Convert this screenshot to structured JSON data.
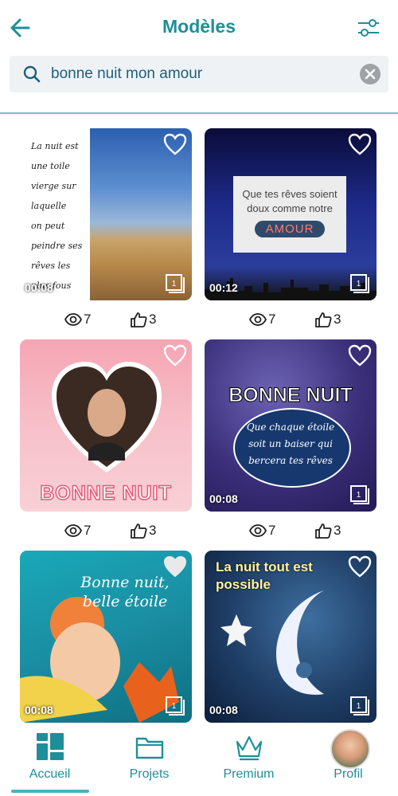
{
  "header": {
    "title": "Modèles"
  },
  "search": {
    "value": "bonne nuit mon amour",
    "placeholder": ""
  },
  "cards": [
    {
      "duration": "00:08",
      "views": "7",
      "likes": "3",
      "pages": "1",
      "poem": [
        "La nuit est",
        "une toile",
        "vierge sur",
        "laquelle",
        "on peut",
        "peindre ses",
        "rêves les",
        "plus fous"
      ]
    },
    {
      "duration": "00:12",
      "views": "7",
      "likes": "3",
      "pages": "1",
      "message": "Que tes rêves soient doux comme notre",
      "pill": "AMOUR"
    },
    {
      "title": "BONNE NUIT",
      "views": "7",
      "likes": "3"
    },
    {
      "duration": "00:08",
      "views": "7",
      "likes": "3",
      "pages": "1",
      "title": "BONNE NUIT",
      "subtitle": "Que chaque étoile soit un baiser qui bercera tes rêves"
    },
    {
      "duration": "00:08",
      "pages": "1",
      "title": "Bonne nuit, belle étoile"
    },
    {
      "duration": "00:08",
      "pages": "1",
      "title": "La nuit tout est possible"
    }
  ],
  "nav": [
    {
      "label": "Accueil",
      "active": true
    },
    {
      "label": "Projets",
      "active": false
    },
    {
      "label": "Premium",
      "active": false
    },
    {
      "label": "Profil",
      "active": false
    }
  ],
  "colors": {
    "accent": "#1e8f98",
    "active_tab": "#48b3c0",
    "divider": "#1e8f98"
  }
}
